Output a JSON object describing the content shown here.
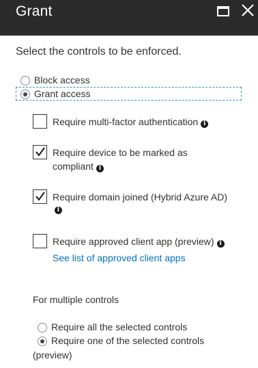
{
  "header": {
    "title": "Grant"
  },
  "instruction": "Select the controls to be enforced.",
  "access_options": [
    {
      "label": "Block access",
      "selected": false
    },
    {
      "label": "Grant access",
      "selected": true
    }
  ],
  "controls": [
    {
      "label": "Require multi-factor authentication",
      "checked": false
    },
    {
      "label": "Require device to be marked as compliant",
      "checked": true
    },
    {
      "label": "Require domain joined (Hybrid Azure AD)",
      "checked": true
    },
    {
      "label": "Require approved client app (preview)",
      "checked": false,
      "link": "See list of approved client apps"
    }
  ],
  "multiple": {
    "heading": "For multiple controls",
    "options": [
      {
        "label": "Require all the selected controls",
        "selected": false
      },
      {
        "label": "Require one of the selected controls",
        "continuation": "(preview)",
        "selected": true
      }
    ]
  },
  "colors": {
    "header_bg": "#2b2b2b",
    "link": "#0072c6",
    "focus_outline": "#2b8fc4"
  }
}
